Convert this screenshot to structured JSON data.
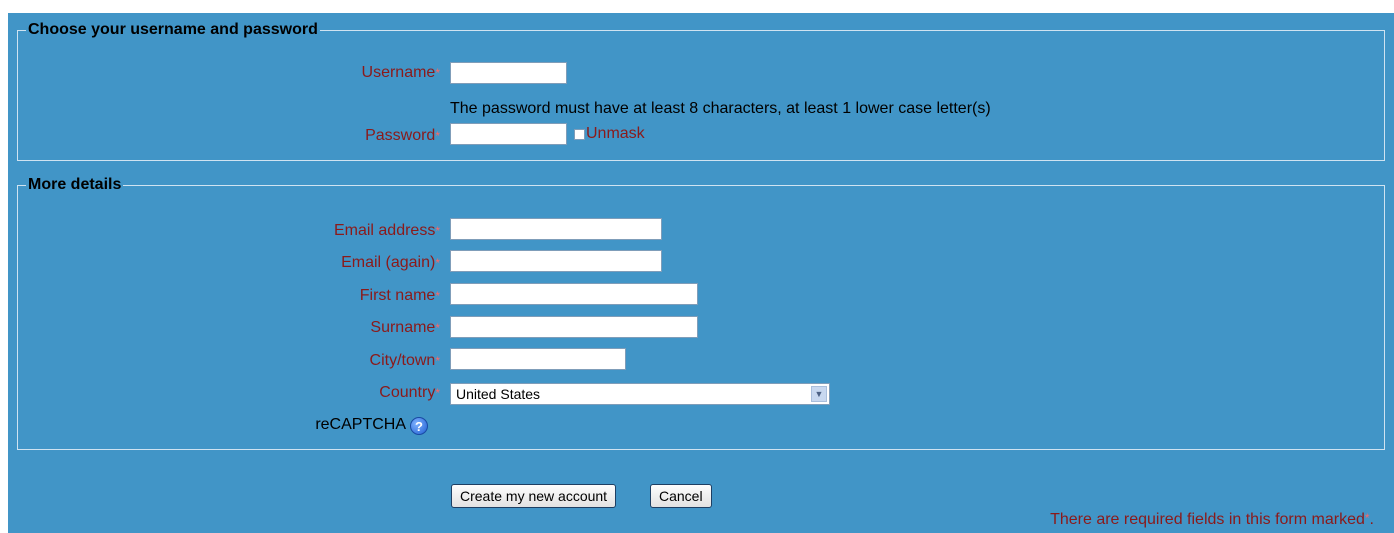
{
  "sections": {
    "credentials_title": "Choose your username and password",
    "details_title": "More details"
  },
  "fields": {
    "username_label": "Username",
    "username_value": "",
    "password_help": "The password must have at least 8 characters, at least 1 lower case letter(s)",
    "password_label": "Password",
    "password_value": "",
    "unmask_label": "Unmask",
    "email_label": "Email address",
    "email_again_label": "Email (again)",
    "first_name_label": "First name",
    "surname_label": "Surname",
    "city_label": "City/town",
    "country_label": "Country",
    "country_value": "United States",
    "recaptcha_label": "reCAPTCHA"
  },
  "required_marker": "*",
  "buttons": {
    "create": "Create my new account",
    "cancel": "Cancel"
  },
  "footer": {
    "required_note": "There are required fields in this form marked"
  },
  "colors": {
    "panel_bg": "#4195c7",
    "label": "#8b1a1a",
    "required_star": "#ff6666"
  }
}
